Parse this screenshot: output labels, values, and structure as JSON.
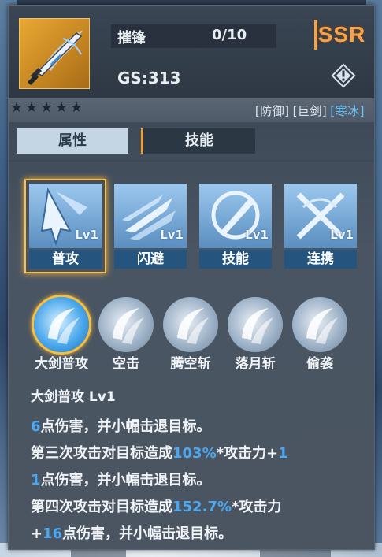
{
  "weapon": {
    "name": "摧锋",
    "count": "0/10",
    "gs": "GS:313",
    "rarity": "SSR",
    "star_count": 5,
    "tags": [
      {
        "text": "[防御]",
        "color": "#dfe5ec"
      },
      {
        "text": "[巨剑]",
        "color": "#dfe5ec"
      },
      {
        "text": "[寒冰]",
        "color": "#6fc6ff"
      }
    ]
  },
  "tabs": {
    "attributes": "属性",
    "skills": "技能"
  },
  "skills": [
    {
      "label": "普攻",
      "level": "Lv1",
      "icon": "normal-attack-icon",
      "selected": true
    },
    {
      "label": "闪避",
      "level": "Lv1",
      "icon": "dodge-icon",
      "selected": false
    },
    {
      "label": "技能",
      "level": "Lv1",
      "icon": "skill-icon",
      "selected": false
    },
    {
      "label": "连携",
      "level": "Lv1",
      "icon": "combo-icon",
      "selected": false
    }
  ],
  "moves": [
    {
      "label": "大剑普攻",
      "icon": "greatsword-slash-icon",
      "selected": true
    },
    {
      "label": "空击",
      "icon": "air-strike-icon",
      "selected": false
    },
    {
      "label": "腾空斩",
      "icon": "aerial-slash-icon",
      "selected": false
    },
    {
      "label": "落月斩",
      "icon": "falling-moon-slash-icon",
      "selected": false
    },
    {
      "label": "偷袭",
      "icon": "sneak-attack-icon",
      "selected": false
    }
  ],
  "description": {
    "title": "大剑普攻 Lv1",
    "lines": [
      [
        {
          "t": "6",
          "hl": true
        },
        {
          "t": "点伤害，并小幅击退目标。",
          "hl": false
        }
      ],
      [
        {
          "t": "第三次攻击对目标造成",
          "hl": false
        },
        {
          "t": "103%",
          "hl": true
        },
        {
          "t": "*攻击力+",
          "hl": false
        },
        {
          "t": "1",
          "hl": true
        }
      ],
      [
        {
          "t": "1",
          "hl": true
        },
        {
          "t": "点伤害，并小幅击退目标。",
          "hl": false
        }
      ],
      [
        {
          "t": "第四次攻击对目标造成",
          "hl": false
        },
        {
          "t": "152.7%",
          "hl": true
        },
        {
          "t": "*攻击力",
          "hl": false
        }
      ],
      [
        {
          "t": "+",
          "hl": false
        },
        {
          "t": "16",
          "hl": true
        },
        {
          "t": "点伤害，并小幅击退目标。",
          "hl": false
        }
      ]
    ]
  },
  "colors": {
    "highlight": "#4ba8f2",
    "ssr": "#f6a24a",
    "selection": "#f5c04d"
  }
}
